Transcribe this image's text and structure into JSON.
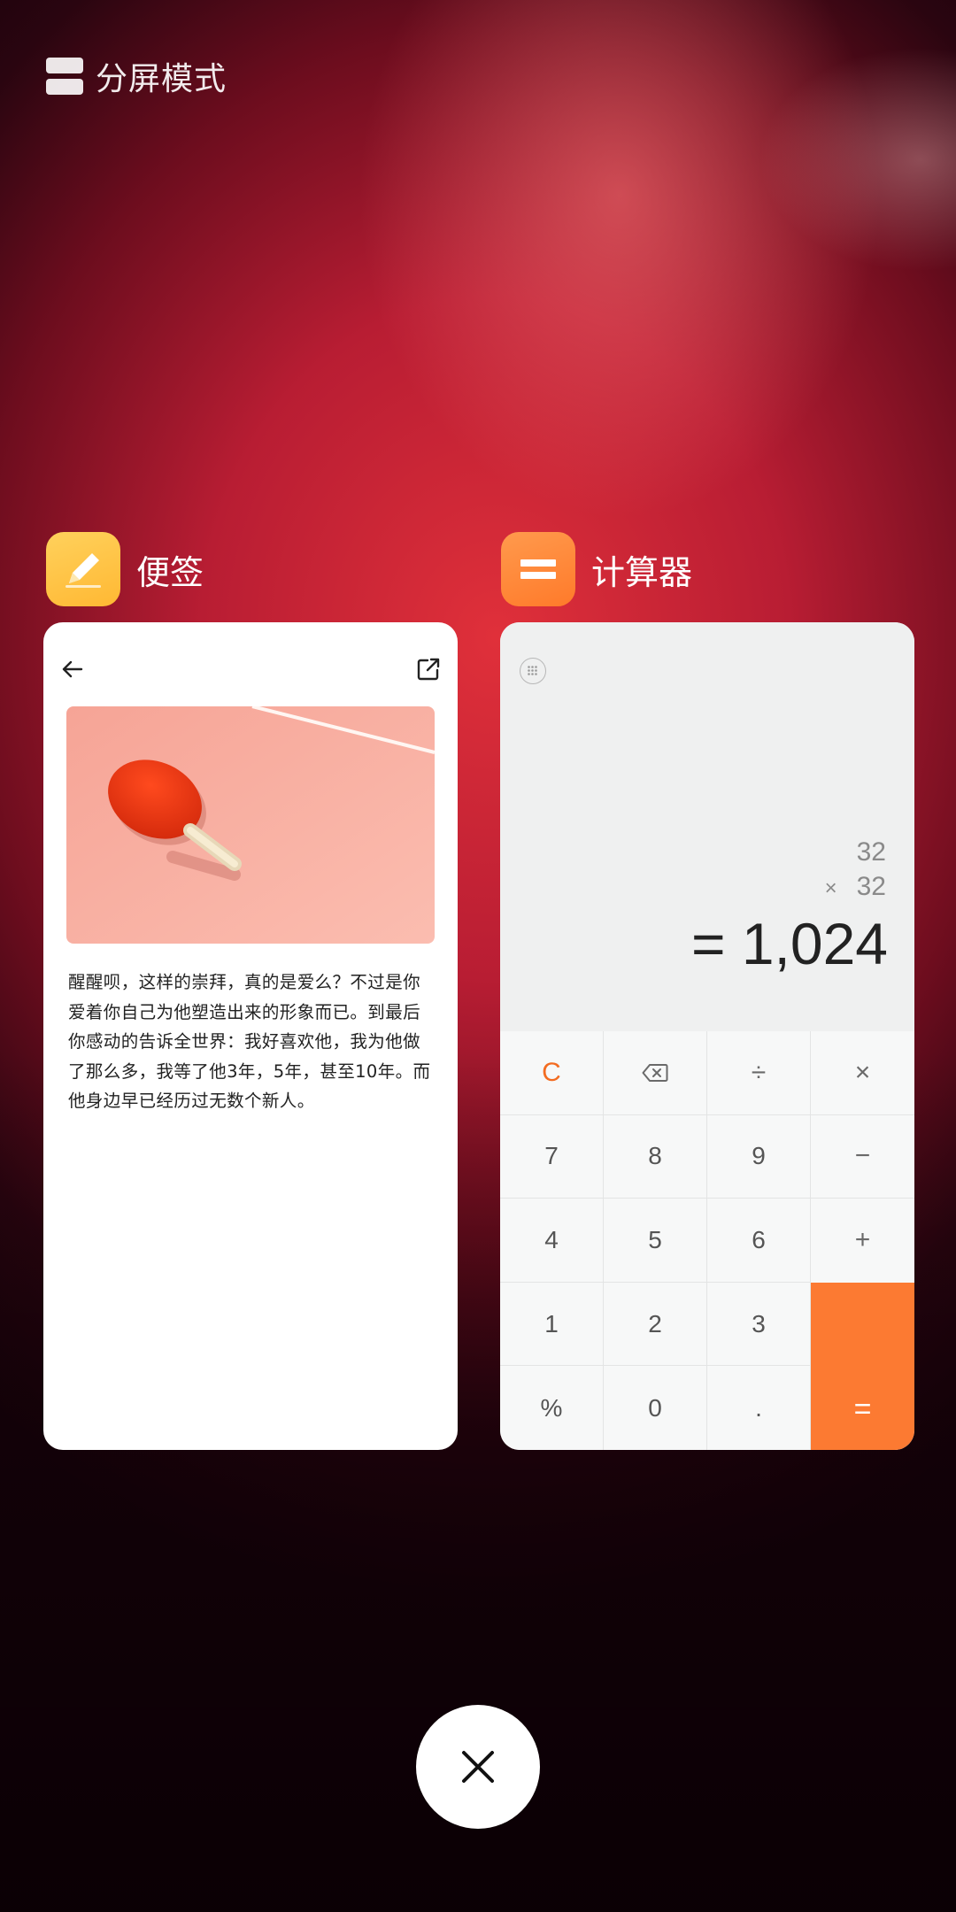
{
  "split_mode": {
    "label": "分屏模式"
  },
  "apps": [
    {
      "name": "便签",
      "icon": "pencil-icon",
      "icon_color": "#FFC24A",
      "note": {
        "text": "醒醒呗，这样的崇拜，真的是爱么？不过是你爱着你自己为他塑造出来的形象而已。到最后你感动的告诉全世界：我好喜欢他，我为他做了那么多，我等了他3年，5年，甚至10年。而他身边早已经历过无数个新人。"
      }
    },
    {
      "name": "计算器",
      "icon": "equals-icon",
      "icon_color": "#FF8A3D",
      "display": {
        "operand1": "32",
        "operator": "×",
        "operand2": "32",
        "result": "= 1,024"
      },
      "keys": [
        [
          "C",
          "⌫",
          "÷",
          "×"
        ],
        [
          "7",
          "8",
          "9",
          "−"
        ],
        [
          "4",
          "5",
          "6",
          "+"
        ],
        [
          "1",
          "2",
          "3",
          ""
        ],
        [
          "%",
          "0",
          ".",
          "="
        ]
      ],
      "accent_color": "#FC7A32"
    }
  ],
  "close": {
    "icon": "close-icon"
  }
}
